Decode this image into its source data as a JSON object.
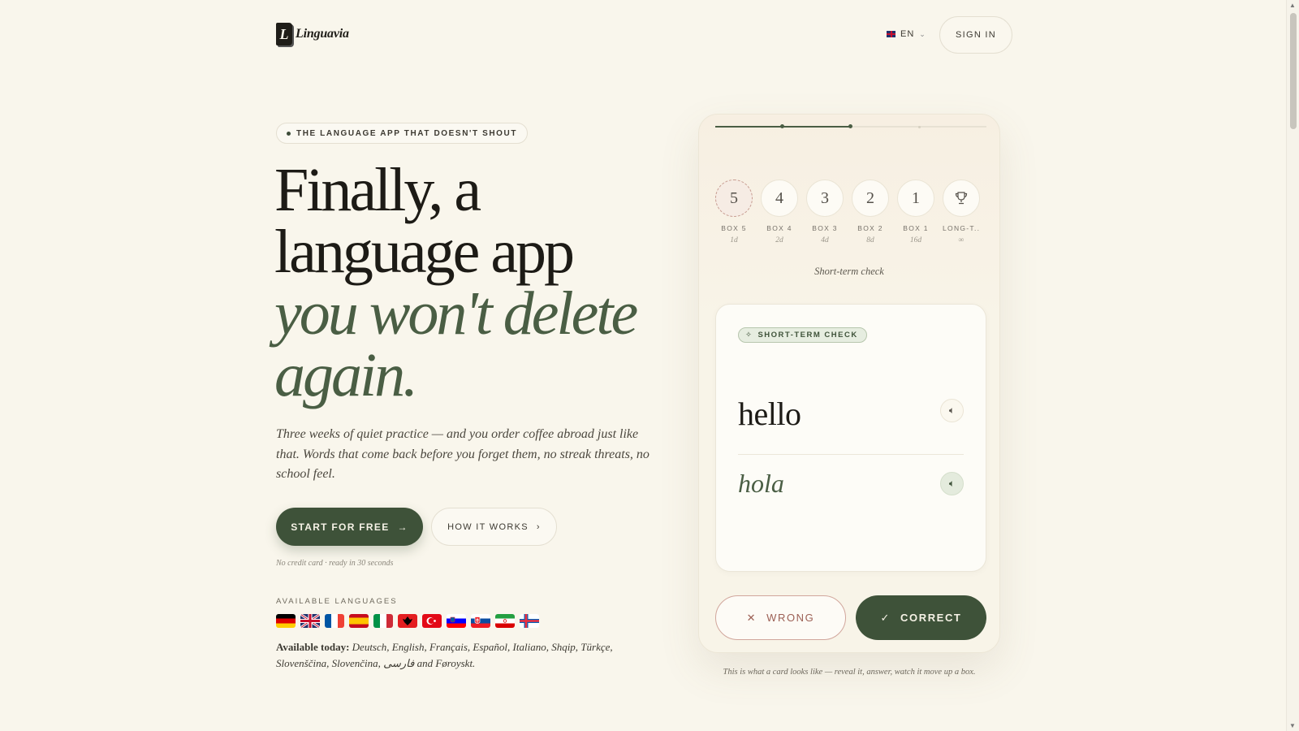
{
  "header": {
    "logo_letter": "L",
    "logo_text": "Linguavia",
    "language_code": "EN",
    "signin_label": "SIGN IN"
  },
  "hero": {
    "tagline": "THE LANGUAGE APP THAT DOESN'T SHOUT",
    "headline_line1": "Finally, a",
    "headline_line2": "language app",
    "headline_em1": "you won't delete",
    "headline_em2": "again.",
    "lede": "Three weeks of quiet practice — and you order coffee abroad just like that. Words that come back before you forget them, no streak threats, no school feel.",
    "cta_primary": "START FOR FREE",
    "cta_secondary": "HOW IT WORKS",
    "fineprint": "No credit card · ready in 30 seconds",
    "available_label": "AVAILABLE LANGUAGES",
    "available_prefix": "Available today:",
    "available_list": "Deutsch, English, Français, Español, Italiano, Shqip, Türkçe, Slovenščina, Slovenčina, فارسی and Føroyskt."
  },
  "flags": [
    "de",
    "gb",
    "fr",
    "es",
    "it",
    "al",
    "tr",
    "si",
    "sk",
    "ir",
    "fo"
  ],
  "demo": {
    "boxes": [
      {
        "num": "5",
        "name": "BOX 5",
        "interval": "1d",
        "active": true
      },
      {
        "num": "4",
        "name": "BOX 4",
        "interval": "2d",
        "active": false
      },
      {
        "num": "3",
        "name": "BOX 3",
        "interval": "4d",
        "active": false
      },
      {
        "num": "2",
        "name": "BOX 2",
        "interval": "8d",
        "active": false
      },
      {
        "num": "1",
        "name": "BOX 1",
        "interval": "16d",
        "active": false
      },
      {
        "num": "",
        "name": "LONG-T...",
        "interval": "∞",
        "icon": "trophy-icon",
        "active": false
      }
    ],
    "phase_label": "Short-term check",
    "card_badge": "SHORT-TERM CHECK",
    "word": "hello",
    "translation": "hola",
    "wrong_label": "WRONG",
    "correct_label": "CORRECT",
    "progress": 0.5,
    "caption": "This is what a card looks like — reveal it, answer, watch it move up a box."
  },
  "colors": {
    "background": "#f9f6ec",
    "accent": "#3e5239",
    "accent_italic": "#4a5e44",
    "wrong": "#9c5f54"
  }
}
